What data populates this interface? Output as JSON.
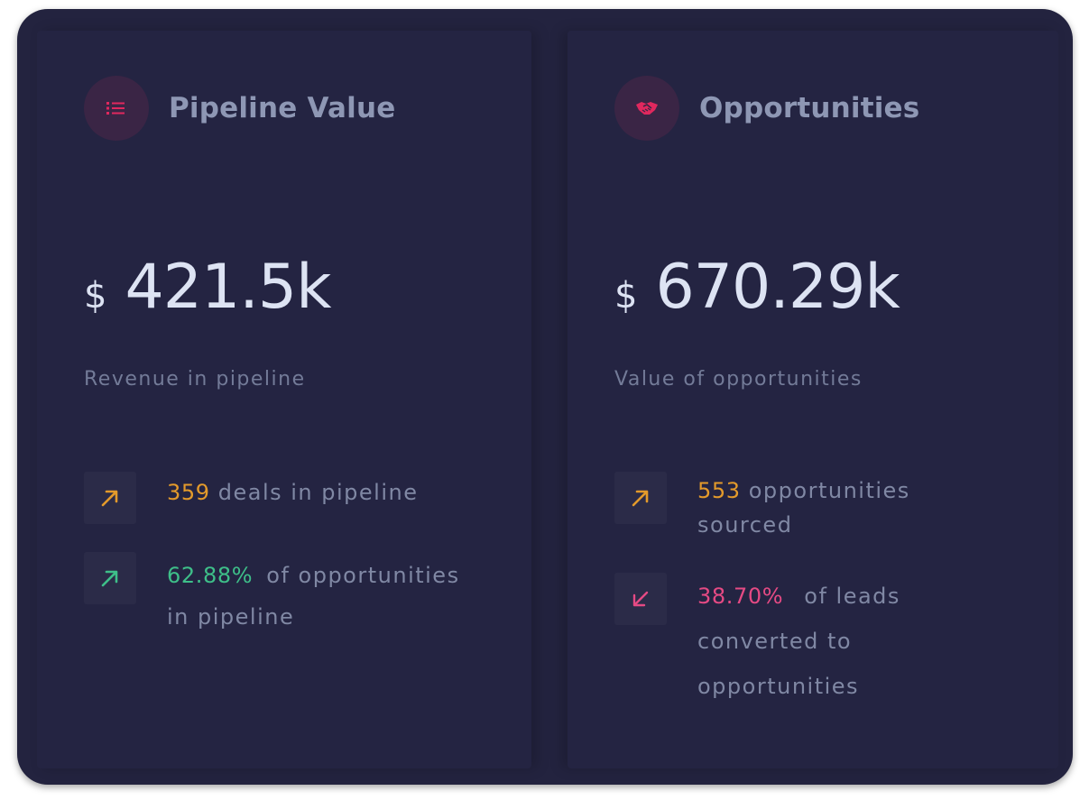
{
  "cards": [
    {
      "title": "Pipeline Value",
      "icon": "list-icon",
      "currency": "$",
      "amount": "421.5k",
      "subtitle": "Revenue in pipeline",
      "stats": [
        {
          "icon": "arrow-up-right-icon",
          "value": "359",
          "text_lines": [
            "deals in pipeline"
          ],
          "color": "#e39a2b"
        },
        {
          "icon": "arrow-up-right-icon",
          "value": "62.88%",
          "text_lines": [
            "of opportunities",
            "in pipeline"
          ],
          "color": "#3ebf89"
        }
      ]
    },
    {
      "title": "Opportunities",
      "icon": "handshake-icon",
      "currency": "$",
      "amount": "670.29k",
      "subtitle": "Value of opportunities",
      "stats": [
        {
          "icon": "arrow-up-right-icon",
          "value": "553",
          "text_lines": [
            "opportunities",
            "sourced"
          ],
          "color": "#e39a2b"
        },
        {
          "icon": "arrow-down-left-icon",
          "value": "38.70%",
          "text_lines": [
            "of leads",
            "converted to",
            "opportunities"
          ],
          "color": "#e54a84"
        }
      ]
    }
  ],
  "colors": {
    "background": "#23233f",
    "card": "#242442",
    "accent_icon": "#e0285e"
  }
}
